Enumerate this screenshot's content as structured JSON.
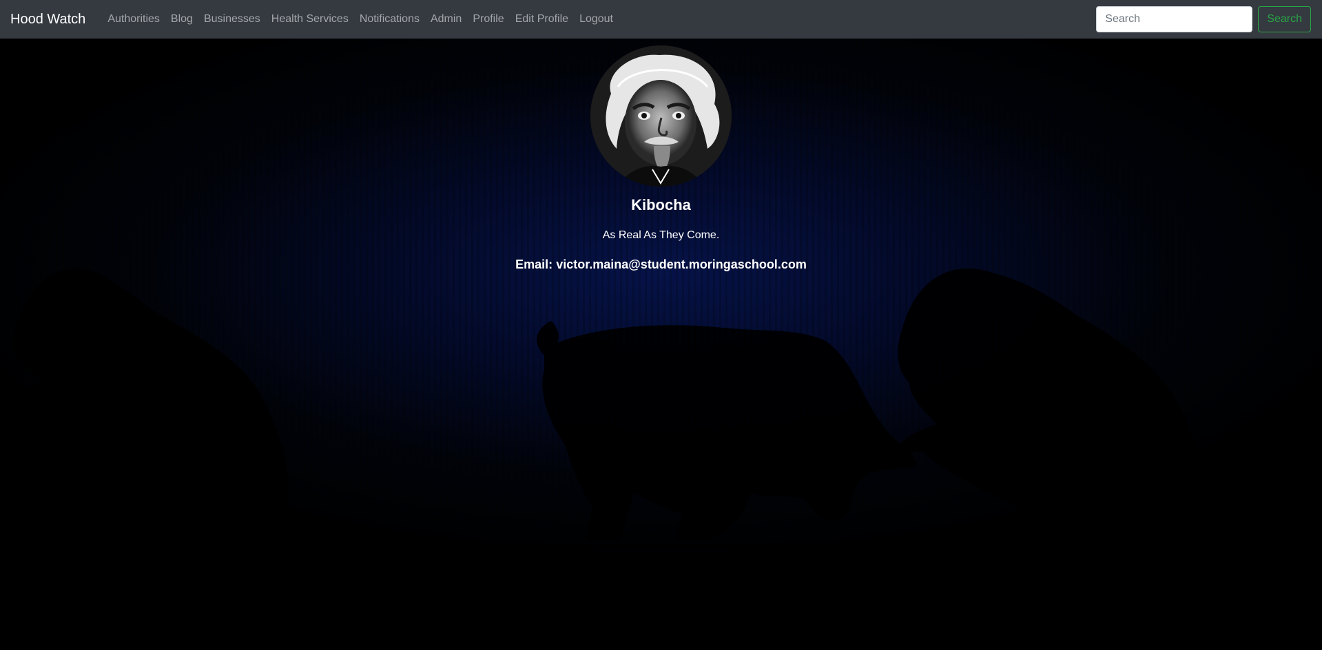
{
  "navbar": {
    "brand": "Hood Watch",
    "links": [
      "Authorities",
      "Blog",
      "Businesses",
      "Health Services",
      "Notifications",
      "Admin",
      "Profile",
      "Edit Profile",
      "Logout"
    ],
    "search_placeholder": "Search",
    "search_button_label": "Search"
  },
  "profile": {
    "username": "Kibocha",
    "bio": "As Real As They Come.",
    "email_label": "Email:",
    "email": "victor.maina@student.moringaschool.com"
  },
  "colors": {
    "navbar_bg": "#343a40",
    "accent_green": "#28a745",
    "background_navy": "#061349"
  },
  "background": {
    "icons": [
      "bear-silhouette-icon",
      "bull-silhouette-icon",
      "bear-silhouette-icon"
    ]
  }
}
